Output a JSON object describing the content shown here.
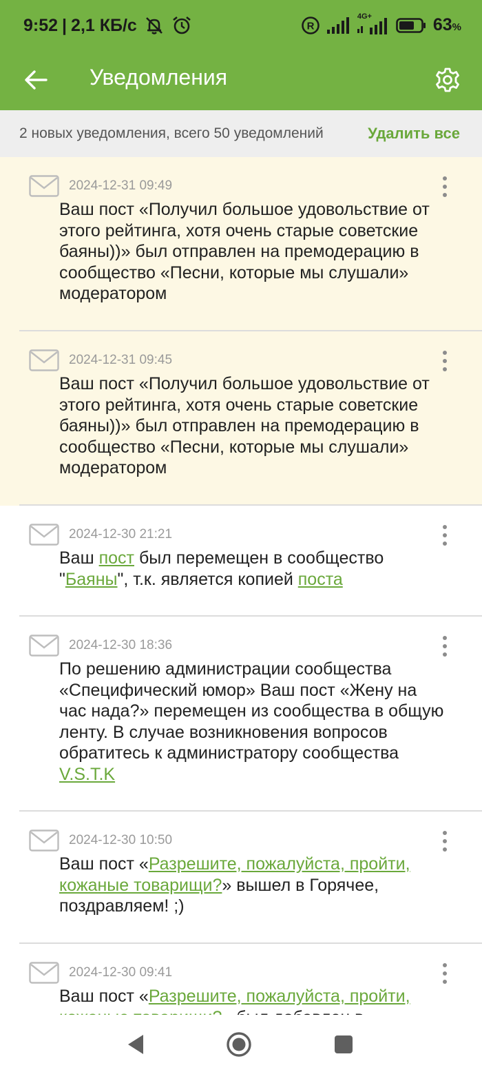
{
  "status_bar": {
    "time": "9:52",
    "separator": "|",
    "speed": "2,1 КБ/с",
    "net_label": "4G+",
    "battery_pct": "63",
    "battery_unit": "%",
    "icons": [
      "mute-bell-icon",
      "alarm-icon",
      "registered-icon",
      "signal-icon",
      "signal-4g-icon",
      "battery-icon"
    ]
  },
  "app_bar": {
    "title": "Уведомления",
    "icons": [
      "back-arrow-icon",
      "gear-icon"
    ]
  },
  "summary": {
    "text": "2 новых уведомления, всего 50 уведомлений",
    "delete_all": "Удалить все"
  },
  "colors": {
    "header": "#74b243",
    "accent": "#6aa83b",
    "unread_bg": "#fdf8e4",
    "summary_bg": "#eeeeee"
  },
  "notifications": [
    {
      "date": "2024-12-31 09:49",
      "unread": true,
      "parts": [
        {
          "t": "Ваш пост «Получил большое удовольствие от этого рейтинга, хотя очень старые советские баяны))» был отправлен на премодерацию в сообщество «Песни, которые мы слушали» модератором"
        }
      ]
    },
    {
      "date": "2024-12-31 09:45",
      "unread": true,
      "parts": [
        {
          "t": "Ваш пост «Получил большое удовольствие от этого рейтинга, хотя очень старые советские баяны))» был отправлен на премодерацию в сообщество «Песни, которые мы слушали» модератором"
        }
      ]
    },
    {
      "date": "2024-12-30 21:21",
      "unread": false,
      "parts": [
        {
          "t": "Ваш "
        },
        {
          "t": "пост",
          "link": true
        },
        {
          "t": " был перемещен в сообщество \""
        },
        {
          "t": "Баяны",
          "link": true
        },
        {
          "t": "\", т.к. является копией "
        },
        {
          "t": "поста",
          "link": true
        }
      ]
    },
    {
      "date": "2024-12-30 18:36",
      "unread": false,
      "parts": [
        {
          "t": "По решению администрации сообщества «Специфический юмор» Ваш пост «Жену на час нада?» перемещен из сообщества в общую ленту. В случае возникновения вопросов обратитесь к администратору сообщества "
        },
        {
          "t": "V.S.T.K",
          "link": true
        }
      ]
    },
    {
      "date": "2024-12-30 10:50",
      "unread": false,
      "parts": [
        {
          "t": "Ваш пост «"
        },
        {
          "t": "Разрешите, пожалуйста, пройти, кожаные товарищи?",
          "link": true
        },
        {
          "t": "» вышел в Горячее, поздравляем! ;)"
        }
      ]
    },
    {
      "date": "2024-12-30 09:41",
      "unread": false,
      "parts": [
        {
          "t": "Ваш пост «"
        },
        {
          "t": "Разрешите, пожалуйста, пройти, кожаные товарищи?",
          "link": true
        },
        {
          "t": "» был добавлен в сообщество"
        }
      ]
    }
  ],
  "nav": {
    "icons": [
      "nav-back-icon",
      "nav-home-icon",
      "nav-recents-icon"
    ]
  }
}
